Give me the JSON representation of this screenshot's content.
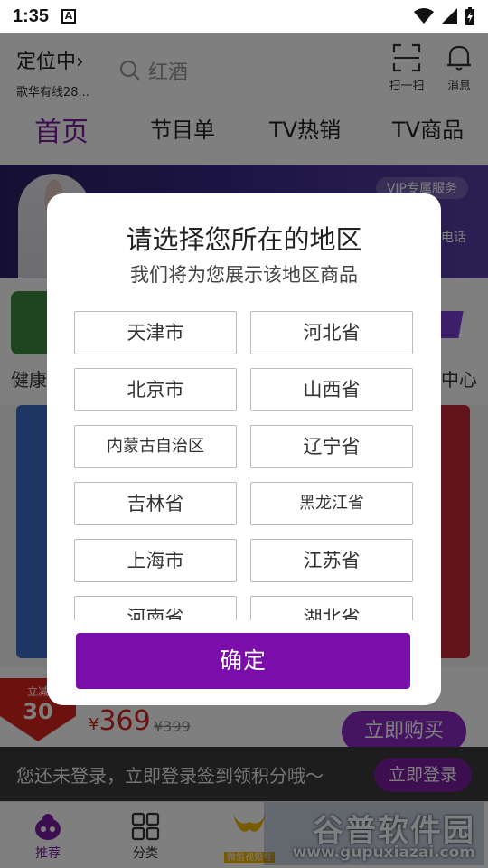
{
  "status": {
    "time": "1:35",
    "notif_glyph": "A"
  },
  "header": {
    "location": "定位中",
    "location_chevron": "›",
    "location_sub": "歌华有线28...",
    "search_placeholder": "红酒",
    "scan_label": "扫一扫",
    "message_label": "消息"
  },
  "tabs": [
    "首页",
    "节目单",
    "TV热销",
    "TV商品"
  ],
  "banner": {
    "vip": "VIP专属服务",
    "tel": "电话"
  },
  "category": {
    "left_label": "健康",
    "right_label": "中心"
  },
  "promo": {
    "reduce_top": "立减",
    "reduce_amount": "30",
    "currency": "¥",
    "price": "369",
    "old_price": "¥399",
    "buy_label": "立即购买"
  },
  "login_bar": {
    "message": "您还未登录，立即登录签到领积分哦～",
    "button": "立即登录"
  },
  "bottom_nav": [
    {
      "label": "推荐"
    },
    {
      "label": "分类"
    },
    {
      "label": "微信视频号"
    }
  ],
  "watermark": {
    "title": "谷普软件园",
    "url": "www.gupuxiazai.com"
  },
  "dialog": {
    "title": "请选择您所在的地区",
    "subtitle": "我们将为您展示该地区商品",
    "regions": [
      "天津市",
      "河北省",
      "北京市",
      "山西省",
      "内蒙古自治区",
      "辽宁省",
      "吉林省",
      "黑龙江省",
      "上海市",
      "江苏省",
      "河南省",
      "湖北省"
    ],
    "confirm": "确定"
  },
  "colors": {
    "accent": "#7b0eaa",
    "price_red": "#d9251c"
  }
}
